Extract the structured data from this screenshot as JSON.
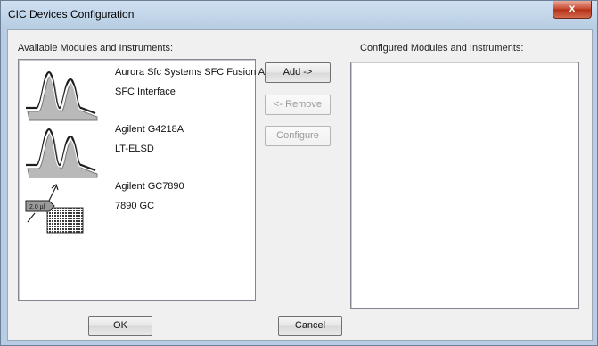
{
  "window": {
    "title": "CIC Devices Configuration",
    "close_glyph": "x"
  },
  "available": {
    "label": "Available Modules and Instruments:",
    "items": [
      {
        "name": "Aurora Sfc Systems SFC Fusion A",
        "sub": "SFC Interface",
        "icon": "chromatogram-icon"
      },
      {
        "name": "Agilent G4218A",
        "sub": "LT-ELSD",
        "icon": "chromatogram-icon"
      },
      {
        "name": "Agilent GC7890",
        "sub": "7890 GC",
        "icon": "gc-injector-icon",
        "icon_label": "2.0 µl"
      }
    ]
  },
  "configured": {
    "label": "Configured Modules and Instruments:"
  },
  "buttons": {
    "add": "Add ->",
    "remove": "<- Remove",
    "configure": "Configure",
    "ok": "OK",
    "cancel": "Cancel"
  }
}
